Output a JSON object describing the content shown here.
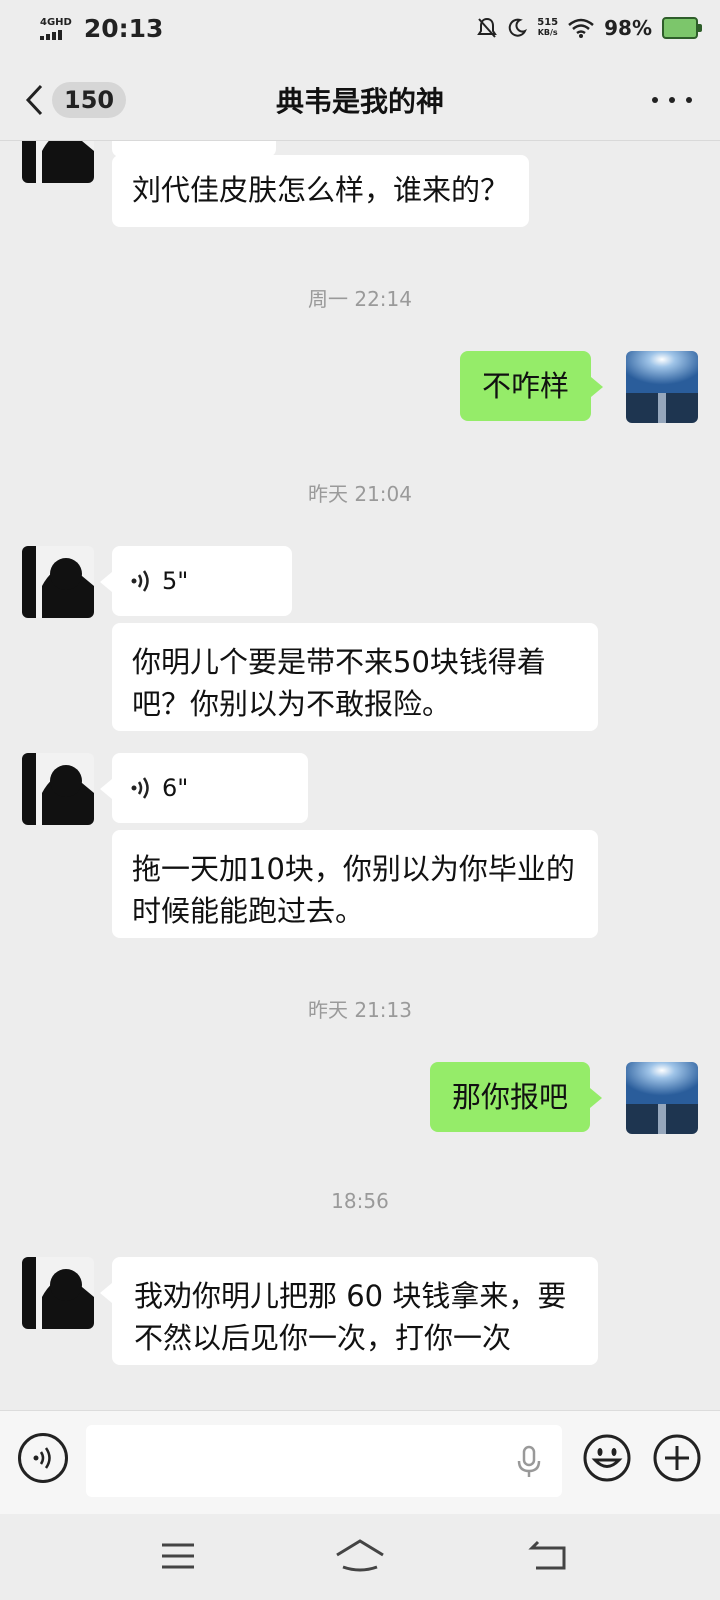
{
  "status_bar": {
    "network": "4GHD",
    "time": "20:13",
    "speed_value": "515",
    "speed_unit": "KB/s",
    "battery": "98%",
    "icons": [
      "signal-icon",
      "mute-icon",
      "moon-icon",
      "wifi-icon",
      "battery-icon"
    ]
  },
  "header": {
    "back_count": "150",
    "title": "典韦是我的神",
    "icons": [
      "back-arrow-icon",
      "more-icon"
    ]
  },
  "messages": [
    {
      "type": "text",
      "side": "left",
      "text": "刘代佳皮肤怎么样，谁来的？"
    },
    {
      "type": "timestamp",
      "text": "周一 22:14"
    },
    {
      "type": "text",
      "side": "right",
      "text": "不咋样"
    },
    {
      "type": "timestamp",
      "text": "昨天 21:04"
    },
    {
      "type": "voice",
      "side": "left",
      "duration": "5\""
    },
    {
      "type": "text",
      "side": "left",
      "line1": "你明儿个要是带不来50块钱得着",
      "line2": "吧？你别以为不敢报险。"
    },
    {
      "type": "voice",
      "side": "left",
      "duration": "6\""
    },
    {
      "type": "text",
      "side": "left",
      "line1": "拖一天加10块，你别以为你毕业的",
      "line2": "时候能能跑过去。"
    },
    {
      "type": "timestamp",
      "text": "昨天 21:13"
    },
    {
      "type": "text",
      "side": "right",
      "text": "那你报吧"
    },
    {
      "type": "timestamp",
      "text": "18:56"
    },
    {
      "type": "text",
      "side": "left",
      "line1": "我劝你明儿把那 60 块钱拿来，要",
      "line2": "不然以后见你一次，打你一次"
    }
  ],
  "input_bar": {
    "icons": [
      "voice-mode-icon",
      "mic-icon",
      "emoji-icon",
      "plus-icon"
    ]
  },
  "nav_bar": {
    "icons": [
      "menu-icon",
      "home-icon",
      "back-icon"
    ]
  }
}
